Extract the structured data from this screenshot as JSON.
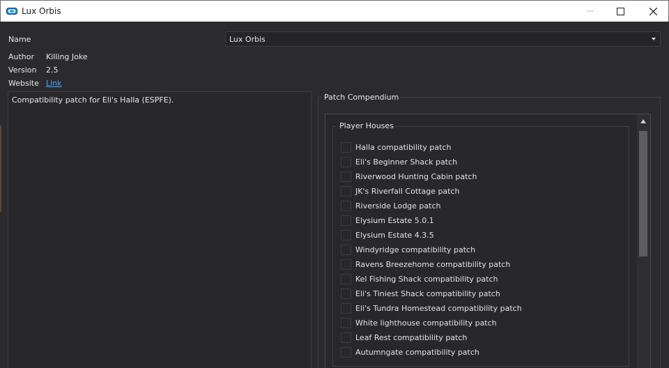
{
  "window": {
    "title": "Lux Orbis"
  },
  "form": {
    "name_label": "Name",
    "name_value": "Lux Orbis",
    "author_label": "Author",
    "author_value": "Killing Joke",
    "version_label": "Version",
    "version_value": "2.5",
    "website_label": "Website",
    "website_link": "Link",
    "description": "Compatibility patch for Eli's Halla (ESPFE)."
  },
  "compendium": {
    "title": "Patch Compendium",
    "group_title": "Player Houses",
    "items": [
      {
        "label": "Halla compatibility patch",
        "checked": false
      },
      {
        "label": "Eli's Beginner Shack patch",
        "checked": false
      },
      {
        "label": "Riverwood Hunting Cabin patch",
        "checked": false
      },
      {
        "label": "JK's Riverfall Cottage patch",
        "checked": false
      },
      {
        "label": "Riverside Lodge patch",
        "checked": false
      },
      {
        "label": "Elysium Estate 5.0.1",
        "checked": false
      },
      {
        "label": "Elysium Estate 4.3.5",
        "checked": false
      },
      {
        "label": "Windyridge compatibility patch",
        "checked": false
      },
      {
        "label": "Ravens Breezehome compatibility patch",
        "checked": false
      },
      {
        "label": "Kel Fishing Shack compatibility patch",
        "checked": false
      },
      {
        "label": "Eli's Tiniest Shack compatibility patch",
        "checked": false
      },
      {
        "label": "Eli's Tundra Homestead compatibility patch",
        "checked": false
      },
      {
        "label": "White lighthouse compatibility patch",
        "checked": false
      },
      {
        "label": "Leaf Rest compatibility patch",
        "checked": false
      },
      {
        "label": "Autumngate compatibility patch",
        "checked": false
      }
    ]
  },
  "colors": {
    "background": "#2b2b2e",
    "link": "#4aa3ff",
    "app_icon": "#1e8fd6"
  }
}
